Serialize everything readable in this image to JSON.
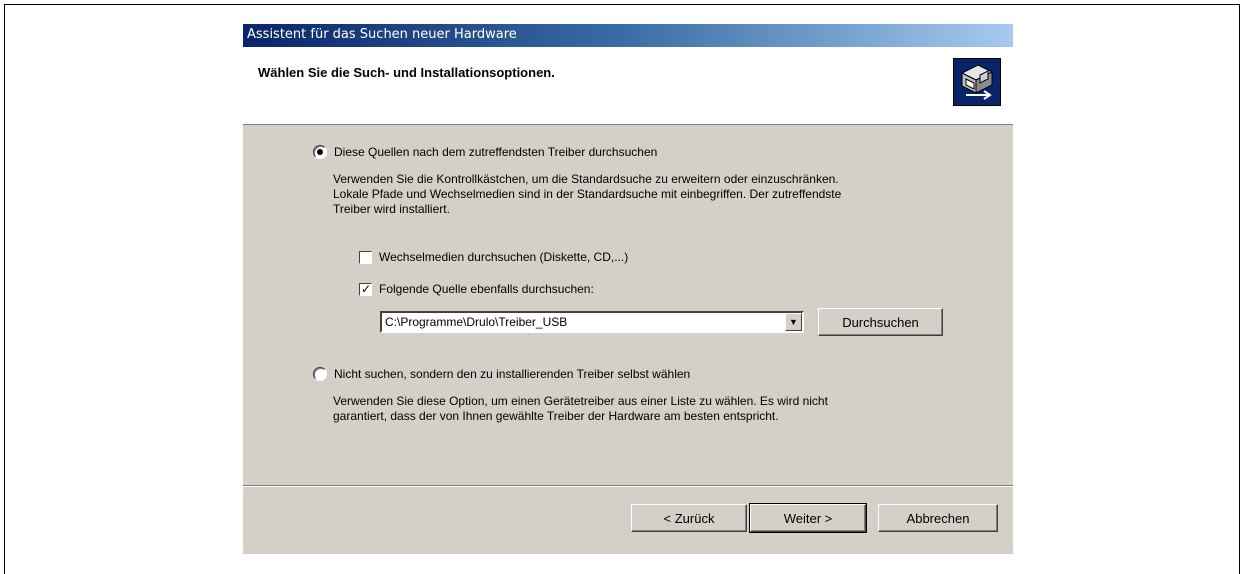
{
  "window": {
    "title": "Assistent für das Suchen neuer Hardware",
    "header_title": "Wählen Sie die Such- und Installationsoptionen.",
    "header_icon": "hardware-wizard-icon"
  },
  "options": {
    "search": {
      "label": "Diese Quellen nach dem zutreffendsten Treiber durchsuchen",
      "selected": true,
      "description_lines": [
        "Verwenden Sie die Kontrollkästchen, um die Standardsuche zu erweitern oder einzuschränken.",
        "Lokale Pfade und Wechselmedien sind in der Standardsuche mit einbegriffen. Der zutreffendste",
        "Treiber wird installiert."
      ],
      "removable_media": {
        "label": "Wechselmedien durchsuchen (Diskette, CD,...)",
        "checked": false
      },
      "include_location": {
        "label": "Folgende Quelle ebenfalls durchsuchen:",
        "checked": true
      },
      "path_value": "C:\\Programme\\Drulo\\Treiber_USB",
      "browse_label": "Durchsuchen"
    },
    "manual": {
      "label": "Nicht suchen, sondern den zu installierenden Treiber selbst wählen",
      "selected": false,
      "description_lines": [
        "Verwenden Sie diese Option, um einen Gerätetreiber aus einer Liste zu wählen. Es wird nicht",
        "garantiert, dass der von Ihnen gewählte Treiber der Hardware am besten entspricht."
      ]
    }
  },
  "buttons": {
    "back": "< Zurück",
    "next": "Weiter >",
    "cancel": "Abbrechen"
  },
  "colors": {
    "dialog_bg": "#d4d0c8",
    "title_start": "#0a246a",
    "title_end": "#a6caf0"
  }
}
